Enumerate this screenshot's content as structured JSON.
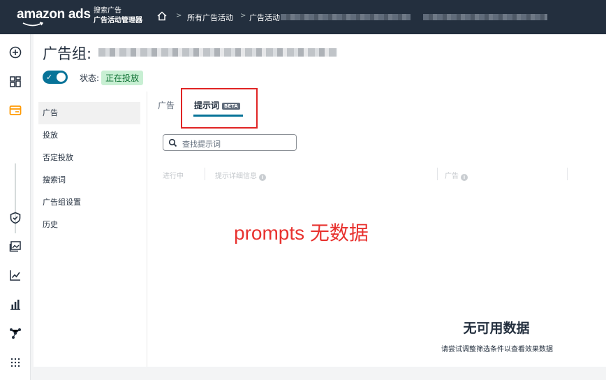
{
  "header": {
    "logo_text": "amazon ads",
    "product_line1": "搜索广告",
    "product_line2": "广告活动管理器",
    "breadcrumbs": [
      "所有广告活动",
      "广告活动"
    ],
    "separator": ">"
  },
  "page": {
    "title": "广告组:",
    "status_label": "状态:",
    "status_value": "正在投放"
  },
  "subnav": {
    "items": [
      "广告",
      "投放",
      "否定投放",
      "搜索词",
      "广告组设置",
      "历史"
    ]
  },
  "tabs": {
    "ads_label": "广告",
    "prompts_label": "提示词",
    "beta_badge": "BETA"
  },
  "search": {
    "placeholder": "查找提示词"
  },
  "table": {
    "columns": [
      "进行中",
      "提示详细信息",
      "广告"
    ],
    "info_glyph": "i"
  },
  "annotation": "prompts 无数据",
  "empty_state": {
    "title": "无可用数据",
    "subtitle": "请尝试调整筛选条件以查看效果数据"
  },
  "colors": {
    "topbar": "#232f3e",
    "accent": "#077398",
    "highlight_box": "#e02424",
    "status_badge_bg": "#c8efd3",
    "nav_active": "#ff9900"
  },
  "icons": {
    "left_nav": [
      "plus-circle-icon",
      "dashboard-icon",
      "campaign-icon",
      "shield-icon",
      "image-gallery-icon",
      "line-chart-icon",
      "bar-chart-icon",
      "network-icon",
      "apps-grid-icon"
    ]
  }
}
